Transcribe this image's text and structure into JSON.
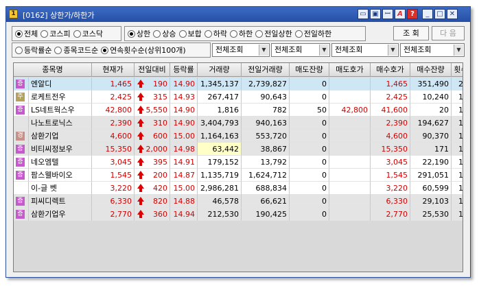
{
  "window": {
    "title": "[0162] 상한가/하한가"
  },
  "titlebar_buttons": [
    "▭",
    "▣",
    "ꟷ",
    "A",
    "?",
    "_",
    "□",
    "✕"
  ],
  "market_filter": {
    "options": [
      "전체",
      "코스피",
      "코스닥"
    ],
    "selected": 0
  },
  "price_filter": {
    "options": [
      "상한",
      "상승",
      "보합",
      "하락",
      "하한",
      "전일상한",
      "전일하한"
    ],
    "selected": 0
  },
  "query_button": "조 회",
  "next_button": "다 음",
  "sort_filter": {
    "options": [
      "등락률순",
      "종목코드순",
      "연속횟수순(상위100개)"
    ],
    "selected": 2
  },
  "selects": [
    "전체조회",
    "전체조회",
    "전체조회",
    "전체조회"
  ],
  "table": {
    "headers": [
      "종목명",
      "현재가",
      "전일대비",
      "등락률",
      "거래량",
      "전일거래량",
      "매도잔량",
      "매도호가",
      "매수호가",
      "매수잔량",
      "횟수"
    ],
    "rows": [
      {
        "badge": "증",
        "badge_color": "m",
        "name": "엔알디",
        "price": "1,465",
        "change": "190",
        "rate": "14.90",
        "volume": "1,345,137",
        "prev_volume": "2,739,827",
        "ask_qty": "0",
        "ask": "",
        "bid": "1,465",
        "bid_qty": "351,490",
        "count": "2",
        "bg": "#cfe6f5"
      },
      {
        "badge": "주",
        "badge_color": "g",
        "name": "로케트전우",
        "price": "2,425",
        "change": "315",
        "rate": "14.93",
        "volume": "267,417",
        "prev_volume": "90,643",
        "ask_qty": "0",
        "ask": "",
        "bid": "2,425",
        "bid_qty": "10,240",
        "count": "1",
        "bg": "#ffffff"
      },
      {
        "badge": "증",
        "badge_color": "m",
        "name": "LS네트웍스우",
        "price": "42,800",
        "change": "5,550",
        "rate": "14.90",
        "volume": "1,816",
        "prev_volume": "782",
        "ask_qty": "50",
        "ask": "42,800",
        "bid": "41,600",
        "bid_qty": "20",
        "count": "1",
        "bg": "#ffffff"
      },
      {
        "badge": "",
        "badge_color": "",
        "name": "나노트로닉스",
        "price": "2,390",
        "change": "310",
        "rate": "14.90",
        "volume": "3,404,793",
        "prev_volume": "940,163",
        "ask_qty": "0",
        "ask": "",
        "bid": "2,390",
        "bid_qty": "194,627",
        "count": "1",
        "bg": "#e4e4e4"
      },
      {
        "badge": "경",
        "badge_color": "o",
        "name": "삼환기업",
        "price": "4,600",
        "change": "600",
        "rate": "15.00",
        "volume": "1,164,163",
        "prev_volume": "553,720",
        "ask_qty": "0",
        "ask": "",
        "bid": "4,600",
        "bid_qty": "90,370",
        "count": "1",
        "bg": "#e4e4e4"
      },
      {
        "badge": "증",
        "badge_color": "m",
        "name": "비티씨정보우",
        "price": "15,350",
        "change": "2,000",
        "rate": "14.98",
        "volume": "63,442",
        "prev_volume": "38,867",
        "ask_qty": "0",
        "ask": "",
        "bid": "15,350",
        "bid_qty": "171",
        "count": "1",
        "bg": "#e4e4e4",
        "volume_highlight": "#ffffc8"
      },
      {
        "badge": "증",
        "badge_color": "m",
        "name": "네오엠텔",
        "price": "3,045",
        "change": "395",
        "rate": "14.91",
        "volume": "179,152",
        "prev_volume": "13,792",
        "ask_qty": "0",
        "ask": "",
        "bid": "3,045",
        "bid_qty": "22,190",
        "count": "1",
        "bg": "#ffffff"
      },
      {
        "badge": "증",
        "badge_color": "m",
        "name": "팜스웰바이오",
        "price": "1,545",
        "change": "200",
        "rate": "14.87",
        "volume": "1,135,719",
        "prev_volume": "1,624,712",
        "ask_qty": "0",
        "ask": "",
        "bid": "1,545",
        "bid_qty": "291,051",
        "count": "1",
        "bg": "#ffffff"
      },
      {
        "badge": "",
        "badge_color": "",
        "name": "이-글 벳",
        "price": "3,220",
        "change": "420",
        "rate": "15.00",
        "volume": "2,986,281",
        "prev_volume": "688,834",
        "ask_qty": "0",
        "ask": "",
        "bid": "3,220",
        "bid_qty": "60,599",
        "count": "1",
        "bg": "#ffffff"
      },
      {
        "badge": "증",
        "badge_color": "m",
        "name": "피씨디렉트",
        "price": "6,330",
        "change": "820",
        "rate": "14.88",
        "volume": "46,578",
        "prev_volume": "66,621",
        "ask_qty": "0",
        "ask": "",
        "bid": "6,330",
        "bid_qty": "29,103",
        "count": "1",
        "bg": "#e4e4e4"
      },
      {
        "badge": "증",
        "badge_color": "m",
        "name": "삼환기업우",
        "price": "2,770",
        "change": "360",
        "rate": "14.94",
        "volume": "212,530",
        "prev_volume": "190,425",
        "ask_qty": "0",
        "ask": "",
        "bid": "2,770",
        "bid_qty": "25,530",
        "count": "1",
        "bg": "#e4e4e4"
      }
    ]
  }
}
